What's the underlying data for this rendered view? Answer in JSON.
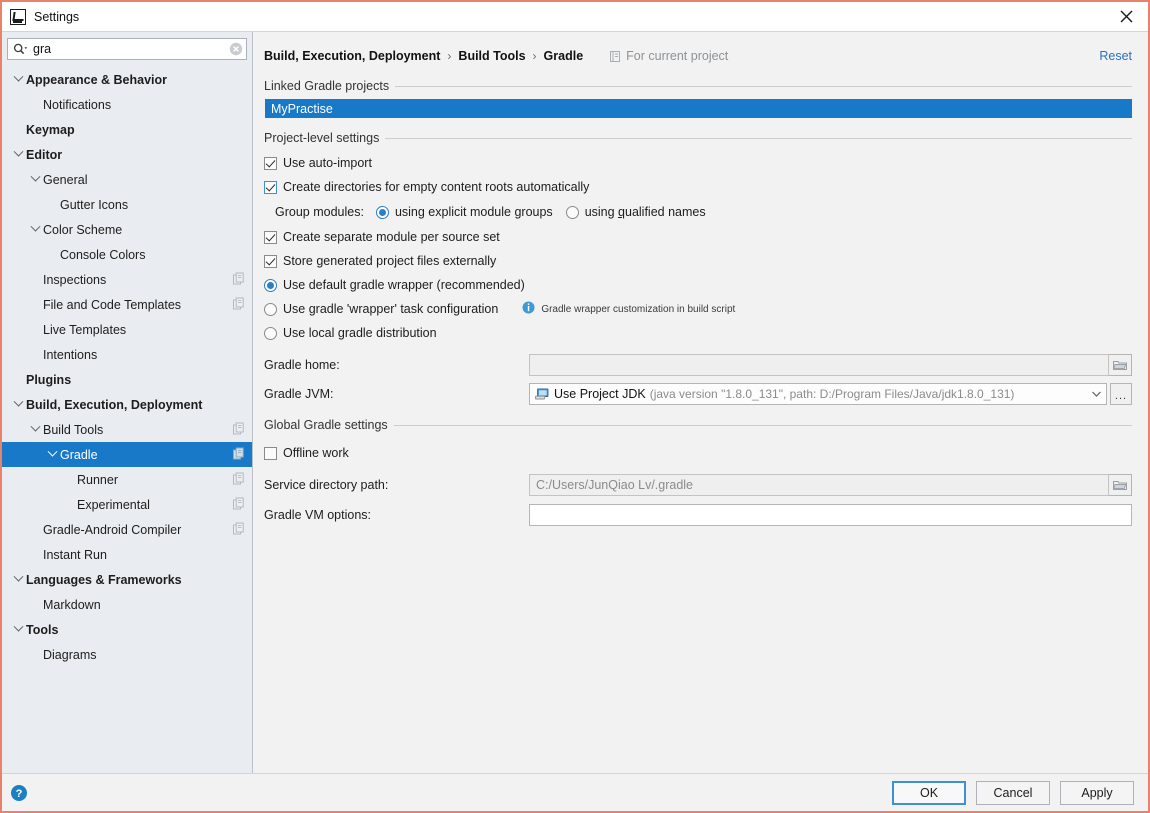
{
  "window": {
    "title": "Settings",
    "logo_icon": "intellij-idea-logo-icon",
    "close_icon": "close-icon"
  },
  "search": {
    "value": "gra",
    "placeholder": "",
    "icon": "search-icon",
    "clear_icon": "clear-icon"
  },
  "sidebar": {
    "items": [
      {
        "label": "Appearance & Behavior",
        "indent": 0,
        "bold": true,
        "chevron": true,
        "selected": false,
        "config_icon": false
      },
      {
        "label": "Notifications",
        "indent": 1,
        "bold": false,
        "chevron": false,
        "selected": false,
        "config_icon": false
      },
      {
        "label": "Keymap",
        "indent": 0,
        "bold": true,
        "chevron": false,
        "selected": false,
        "config_icon": false
      },
      {
        "label": "Editor",
        "indent": 0,
        "bold": true,
        "chevron": true,
        "selected": false,
        "config_icon": false
      },
      {
        "label": "General",
        "indent": 1,
        "bold": false,
        "chevron": true,
        "selected": false,
        "config_icon": false
      },
      {
        "label": "Gutter Icons",
        "indent": 2,
        "bold": false,
        "chevron": false,
        "selected": false,
        "config_icon": false
      },
      {
        "label": "Color Scheme",
        "indent": 1,
        "bold": false,
        "chevron": true,
        "selected": false,
        "config_icon": false
      },
      {
        "label": "Console Colors",
        "indent": 2,
        "bold": false,
        "chevron": false,
        "selected": false,
        "config_icon": false
      },
      {
        "label": "Inspections",
        "indent": 1,
        "bold": false,
        "chevron": false,
        "selected": false,
        "config_icon": true
      },
      {
        "label": "File and Code Templates",
        "indent": 1,
        "bold": false,
        "chevron": false,
        "selected": false,
        "config_icon": true
      },
      {
        "label": "Live Templates",
        "indent": 1,
        "bold": false,
        "chevron": false,
        "selected": false,
        "config_icon": false
      },
      {
        "label": "Intentions",
        "indent": 1,
        "bold": false,
        "chevron": false,
        "selected": false,
        "config_icon": false
      },
      {
        "label": "Plugins",
        "indent": 0,
        "bold": true,
        "chevron": false,
        "selected": false,
        "config_icon": false
      },
      {
        "label": "Build, Execution, Deployment",
        "indent": 0,
        "bold": true,
        "chevron": true,
        "selected": false,
        "config_icon": false
      },
      {
        "label": "Build Tools",
        "indent": 1,
        "bold": false,
        "chevron": true,
        "selected": false,
        "config_icon": true
      },
      {
        "label": "Gradle",
        "indent": 2,
        "bold": false,
        "chevron": true,
        "selected": true,
        "config_icon": true
      },
      {
        "label": "Runner",
        "indent": 3,
        "bold": false,
        "chevron": false,
        "selected": false,
        "config_icon": true
      },
      {
        "label": "Experimental",
        "indent": 3,
        "bold": false,
        "chevron": false,
        "selected": false,
        "config_icon": true
      },
      {
        "label": "Gradle-Android Compiler",
        "indent": 1,
        "bold": false,
        "chevron": false,
        "selected": false,
        "config_icon": true
      },
      {
        "label": "Instant Run",
        "indent": 1,
        "bold": false,
        "chevron": false,
        "selected": false,
        "config_icon": false
      },
      {
        "label": "Languages & Frameworks",
        "indent": 0,
        "bold": true,
        "chevron": true,
        "selected": false,
        "config_icon": false
      },
      {
        "label": "Markdown",
        "indent": 1,
        "bold": false,
        "chevron": false,
        "selected": false,
        "config_icon": false
      },
      {
        "label": "Tools",
        "indent": 0,
        "bold": true,
        "chevron": true,
        "selected": false,
        "config_icon": false
      },
      {
        "label": "Diagrams",
        "indent": 1,
        "bold": false,
        "chevron": false,
        "selected": false,
        "config_icon": false
      }
    ]
  },
  "header": {
    "breadcrumb": [
      "Build, Execution, Deployment",
      "Build Tools",
      "Gradle"
    ],
    "separator": "›",
    "scope_label": "For current project",
    "scope_icon": "project-scope-icon",
    "reset_label": "Reset"
  },
  "main": {
    "linked_projects_group": "Linked Gradle projects",
    "linked_projects": [
      {
        "name": "MyPractise",
        "selected": true
      }
    ],
    "project_settings_group": "Project-level settings",
    "use_auto_import": {
      "label": "Use auto-import",
      "checked": true,
      "accent": false
    },
    "create_directories": {
      "label": "Create directories for empty content roots automatically",
      "checked": true,
      "accent": true
    },
    "group_modules": {
      "label": "Group modules:",
      "options": [
        {
          "label": "using explicit module groups",
          "selected": true,
          "mnemonic": "g"
        },
        {
          "label": "using qualified names",
          "selected": false,
          "mnemonic": "q"
        }
      ]
    },
    "create_separate_module": {
      "label": "Create separate module per source set",
      "checked": true
    },
    "store_generated": {
      "label": "Store generated project files externally",
      "checked": true
    },
    "distribution_options": [
      {
        "label": "Use default gradle wrapper (recommended)",
        "selected": true
      },
      {
        "label": "Use gradle 'wrapper' task configuration",
        "selected": false
      },
      {
        "label": "Use local gradle distribution",
        "selected": false
      }
    ],
    "wrapper_note": {
      "text": "Gradle wrapper customization in build script",
      "icon": "info-icon"
    },
    "gradle_home": {
      "label": "Gradle home:",
      "value": "",
      "placeholder": "",
      "disabled": true,
      "browse_icon": "folder-icon"
    },
    "gradle_jvm": {
      "label": "Gradle JVM:",
      "icon": "jdk-icon",
      "value": "Use Project JDK",
      "detail": "(java version \"1.8.0_131\", path: D:/Program Files/Java/jdk1.8.0_131)",
      "arrow_icon": "chevron-down-icon",
      "ellipsis_label": "..."
    },
    "global_settings_group": "Global Gradle settings",
    "offline_work": {
      "label": "Offline work",
      "checked": false
    },
    "service_directory": {
      "label": "Service directory path:",
      "value": "",
      "placeholder": "C:/Users/JunQiao Lv/.gradle",
      "disabled": true,
      "browse_icon": "folder-icon"
    },
    "vm_options": {
      "label": "Gradle VM options:",
      "value": "",
      "placeholder": ""
    }
  },
  "footer": {
    "help_icon": "help-icon",
    "buttons": [
      {
        "label": "OK",
        "focused": true
      },
      {
        "label": "Cancel",
        "focused": false
      },
      {
        "label": "Apply",
        "focused": false
      }
    ]
  },
  "colors": {
    "selection_blue": "#1879c8",
    "accent_blue": "#2d7fc4",
    "link_blue": "#2a6fc4",
    "sidebar_bg": "#e9edf1",
    "window_border": "#e8826a"
  }
}
